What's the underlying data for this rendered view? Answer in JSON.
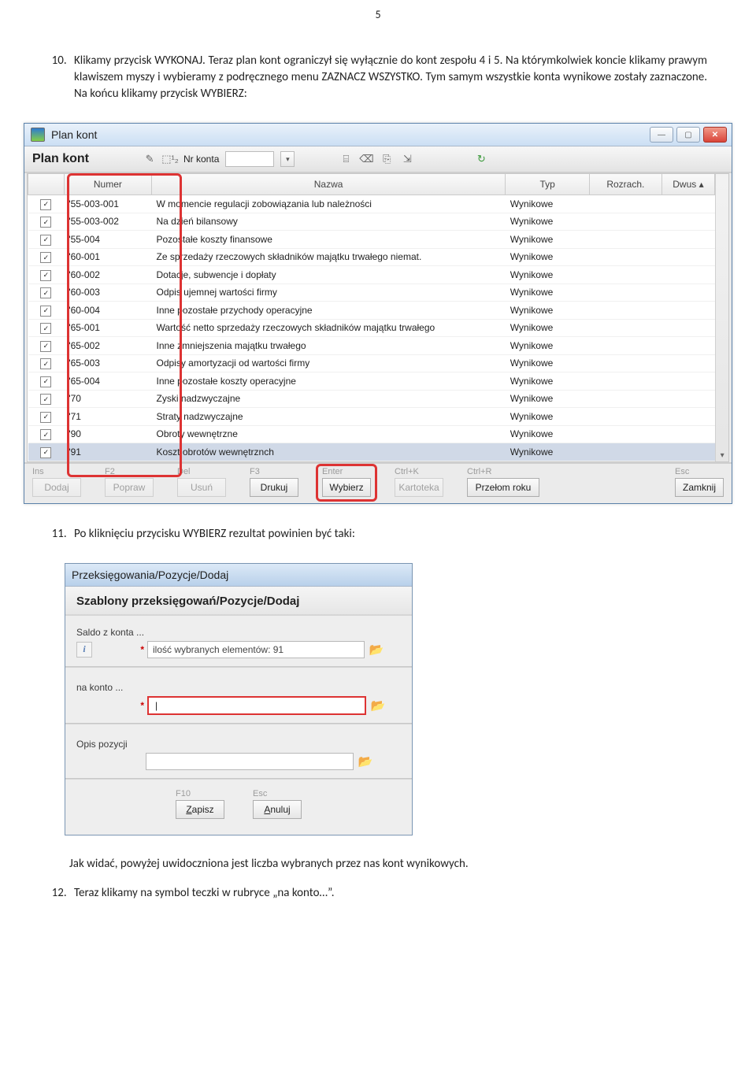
{
  "page_number": "5",
  "para10_num": "10.",
  "para10": "Klikamy przycisk WYKONAJ. Teraz plan kont ograniczył się wyłącznie do kont zespołu 4 i 5. Na którymkolwiek koncie klikamy prawym klawiszem myszy i wybieramy z podręcznego menu ZAZNACZ WSZYSTKO. Tym samym wszystkie konta wynikowe zostały zaznaczone. Na końcu klikamy przycisk WYBIERZ:",
  "win": {
    "title": "Plan kont",
    "min": "—",
    "max": "▢",
    "close": "✕",
    "toolbar_head": "Plan kont",
    "filter1": "✎",
    "filter2": "⬚¹₂",
    "filter_label": "Nr konta",
    "drop": "▾",
    "ico_tree": "⌸",
    "ico_del": "⌫",
    "ico_copy": "⎘",
    "ico_shrink": "⇲",
    "ico_refresh": "↻",
    "cols": {
      "chk": "",
      "num": "Numer",
      "name": "Nazwa",
      "typ": "Typ",
      "roz": "Rozrach.",
      "dw": "Dwus ▴"
    },
    "rows": [
      {
        "num": "'55-003-001",
        "name": "W momencie regulacji zobowiązania lub należności",
        "typ": "Wynikowe"
      },
      {
        "num": "'55-003-002",
        "name": "Na dzień bilansowy",
        "typ": "Wynikowe"
      },
      {
        "num": "'55-004",
        "name": "Pozostałe koszty finansowe",
        "typ": "Wynikowe"
      },
      {
        "num": "'60-001",
        "name": "Ze sprzedaży rzeczowych składników majątku trwałego niemat.",
        "typ": "Wynikowe"
      },
      {
        "num": "'60-002",
        "name": "Dotacje, subwencje i dopłaty",
        "typ": "Wynikowe"
      },
      {
        "num": "'60-003",
        "name": "Odpis ujemnej wartości firmy",
        "typ": "Wynikowe"
      },
      {
        "num": "'60-004",
        "name": "Inne pozostałe przychody operacyjne",
        "typ": "Wynikowe"
      },
      {
        "num": "'65-001",
        "name": "Wartość netto sprzedaży rzeczowych składników majątku trwałego",
        "typ": "Wynikowe"
      },
      {
        "num": "'65-002",
        "name": "Inne zmniejszenia majątku trwałego",
        "typ": "Wynikowe"
      },
      {
        "num": "'65-003",
        "name": "Odpisy amortyzacji od wartości firmy",
        "typ": "Wynikowe"
      },
      {
        "num": "'65-004",
        "name": "Inne pozostałe koszty operacyjne",
        "typ": "Wynikowe"
      },
      {
        "num": "'70",
        "name": "Zyski nadzwyczajne",
        "typ": "Wynikowe"
      },
      {
        "num": "'71",
        "name": "Straty nadzwyczajne",
        "typ": "Wynikowe"
      },
      {
        "num": "'90",
        "name": "Obroty wewnętrzne",
        "typ": "Wynikowe"
      },
      {
        "num": "'91",
        "name": "Koszt obrotów wewnętrznch",
        "typ": "Wynikowe",
        "sel": true
      }
    ],
    "check": "✓",
    "scroll_down": "▾",
    "actions": [
      {
        "hint": "Ins",
        "label": "Dodaj",
        "enabled": false
      },
      {
        "hint": "F2",
        "label": "Popraw",
        "enabled": false
      },
      {
        "hint": "Del",
        "label": "Usuń",
        "enabled": false
      },
      {
        "hint": "F3",
        "label": "Drukuj",
        "enabled": true
      },
      {
        "hint": "Enter",
        "label": "Wybierz",
        "enabled": true,
        "highlight": true
      },
      {
        "hint": "Ctrl+K",
        "label": "Kartoteka",
        "enabled": false
      },
      {
        "hint": "Ctrl+R",
        "label": "Przełom roku",
        "enabled": true
      }
    ],
    "close_action": {
      "hint": "Esc",
      "label": "Zamknij",
      "enabled": true
    }
  },
  "para11_num": "11.",
  "para11": "Po kliknięciu przycisku WYBIERZ rezultat powinien być taki:",
  "dlg": {
    "title": "Przeksięgowania/Pozycje/Dodaj",
    "subhead": "Szablony przeksięgowań/Pozycje/Dodaj",
    "lbl_from": "Saldo z konta ...",
    "val_from": "ilość wybranych elementów: 91",
    "lbl_to": "na konto ...",
    "val_to": "",
    "lbl_desc": "Opis pozycji",
    "ast": "*",
    "folder": "📂",
    "info": "i",
    "caret": "|",
    "f10": "F10",
    "zapisz": "Zapisz",
    "esc": "Esc",
    "anuluj": "Anuluj",
    "zapisz_underline_char": "Z",
    "anuluj_underline_char": "A"
  },
  "para11b": "Jak widać, powyżej uwidoczniona jest liczba wybranych przez nas kont wynikowych.",
  "para12_num": "12.",
  "para12": "Teraz klikamy na symbol teczki w rubryce „na konto…”."
}
